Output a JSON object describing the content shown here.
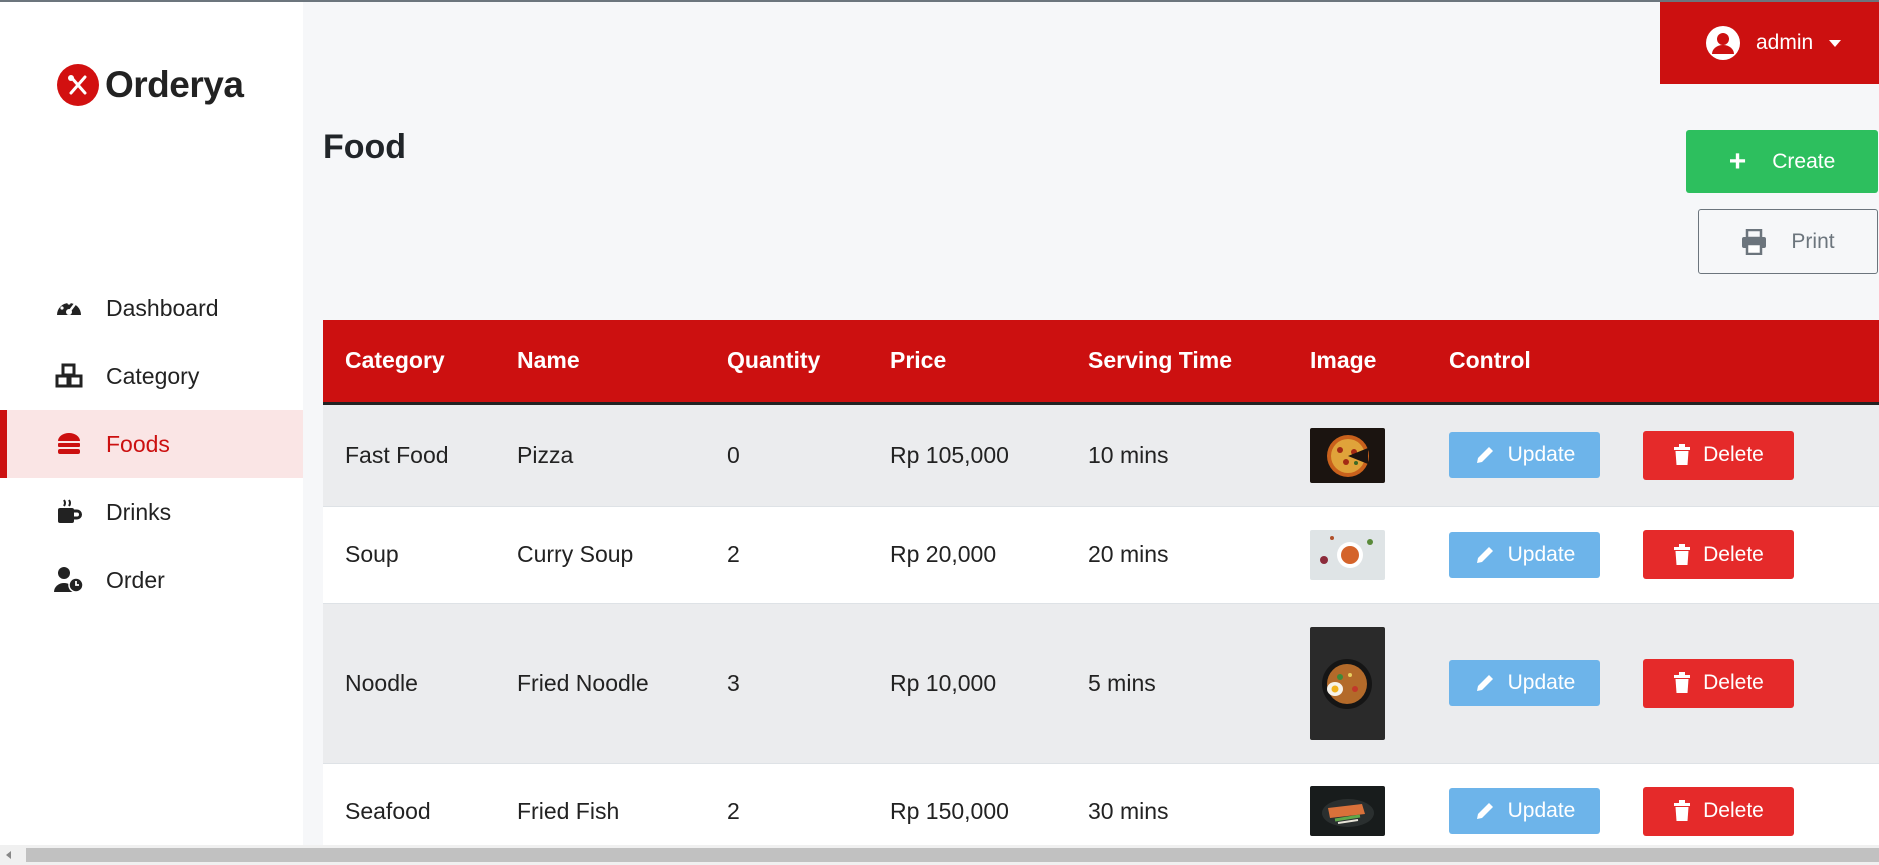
{
  "brand": {
    "name": "Orderya",
    "accent": "#cc1010"
  },
  "user": {
    "name": "admin",
    "icon": "user-circle-icon"
  },
  "sidebar": {
    "items": [
      {
        "label": "Dashboard",
        "icon": "gauge-icon",
        "active": false
      },
      {
        "label": "Category",
        "icon": "cubes-icon",
        "active": false
      },
      {
        "label": "Foods",
        "icon": "burger-icon",
        "active": true
      },
      {
        "label": "Drinks",
        "icon": "mug-icon",
        "active": false
      },
      {
        "label": "Order",
        "icon": "user-clock-icon",
        "active": false
      }
    ]
  },
  "page": {
    "title": "Food"
  },
  "actions": {
    "create_label": "Create",
    "print_label": "Print"
  },
  "table": {
    "columns": [
      "Category",
      "Name",
      "Quantity",
      "Price",
      "Serving Time",
      "Image",
      "Control"
    ],
    "update_label": "Update",
    "delete_label": "Delete",
    "rows": [
      {
        "category": "Fast Food",
        "name": "Pizza",
        "quantity": "0",
        "price": "Rp 105,000",
        "serving_time": "10 mins",
        "image": "pizza-image"
      },
      {
        "category": "Soup",
        "name": "Curry Soup",
        "quantity": "2",
        "price": "Rp 20,000",
        "serving_time": "20 mins",
        "image": "curry-soup-image"
      },
      {
        "category": "Noodle",
        "name": "Fried Noodle",
        "quantity": "3",
        "price": "Rp 10,000",
        "serving_time": "5 mins",
        "image": "fried-noodle-image"
      },
      {
        "category": "Seafood",
        "name": "Fried Fish",
        "quantity": "2",
        "price": "Rp 150,000",
        "serving_time": "30 mins",
        "image": "fried-fish-image"
      }
    ]
  }
}
